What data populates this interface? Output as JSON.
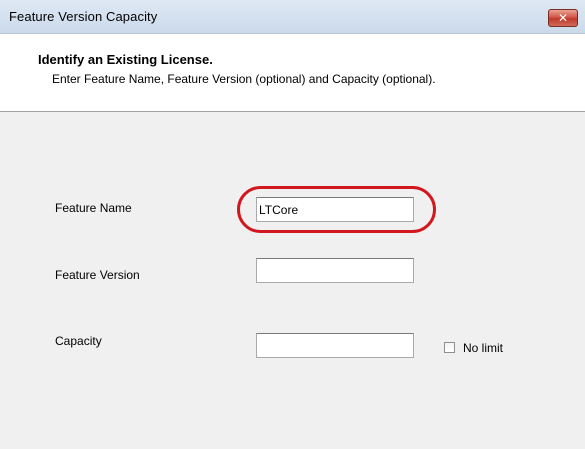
{
  "window": {
    "title": "Feature Version Capacity",
    "close_symbol": "✕"
  },
  "header": {
    "title": "Identify an Existing License.",
    "subtitle": "Enter Feature Name, Feature Version (optional) and Capacity (optional)."
  },
  "form": {
    "feature_name": {
      "label": "Feature Name",
      "value": "LTCore"
    },
    "feature_version": {
      "label": "Feature Version",
      "value": ""
    },
    "capacity": {
      "label": "Capacity",
      "value": ""
    },
    "no_limit": {
      "label": "No limit",
      "checked": false
    }
  },
  "colors": {
    "highlight_ring": "#d2171f",
    "titlebar": "#dfe9f5",
    "dialog_body": "#f0f0f0",
    "close_button": "#c0392b"
  },
  "icons": {
    "close": "close-icon"
  }
}
